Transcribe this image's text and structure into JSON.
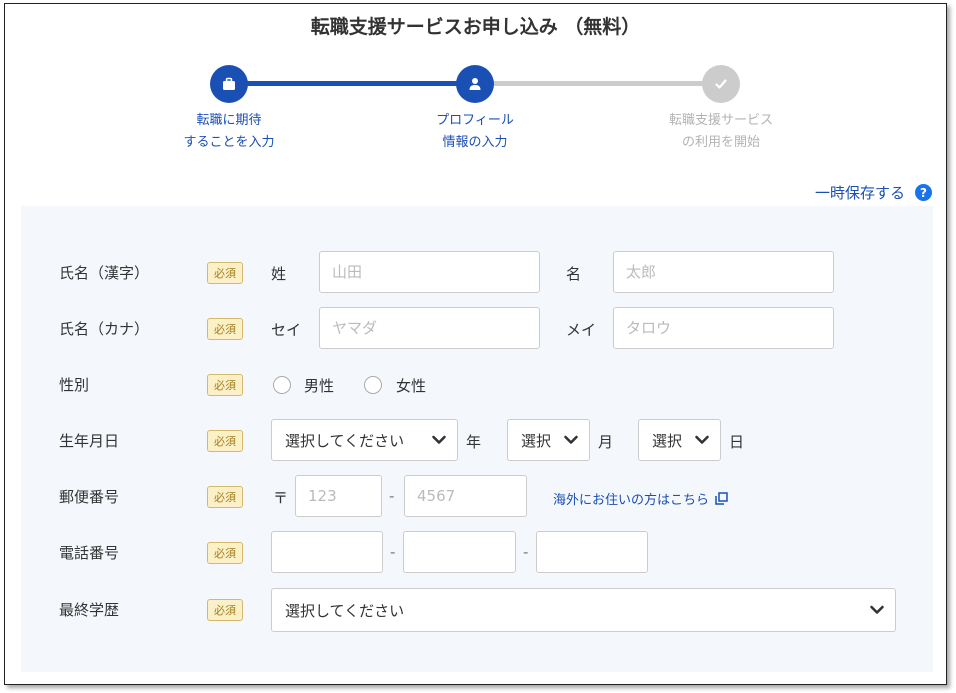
{
  "title": "転職支援サービスお申し込み （無料）",
  "steps": [
    {
      "line1": "転職に期待",
      "line2": "することを入力",
      "icon": "briefcase-icon",
      "state": "active"
    },
    {
      "line1": "プロフィール",
      "line2": "情報の入力",
      "icon": "person-icon",
      "state": "active"
    },
    {
      "line1": "転職支援サービス",
      "line2": "の利用を開始",
      "icon": "check-icon",
      "state": "inactive"
    }
  ],
  "save_link": "一時保存する",
  "help_icon": "?",
  "required_badge": "必須",
  "colors": {
    "accent": "#1a4fb4",
    "inactive": "#cccccc",
    "form_bg": "#f4f8fd",
    "badge_bg": "#fbf0c8"
  },
  "fields": {
    "name_kanji": {
      "label": "氏名（漢字）",
      "last_label": "姓",
      "last_placeholder": "山田",
      "first_label": "名",
      "first_placeholder": "太郎"
    },
    "name_kana": {
      "label": "氏名（カナ）",
      "last_label": "セイ",
      "last_placeholder": "ヤマダ",
      "first_label": "メイ",
      "first_placeholder": "タロウ"
    },
    "gender": {
      "label": "性別",
      "options": [
        "男性",
        "女性"
      ]
    },
    "birthdate": {
      "label": "生年月日",
      "year_value": "選択してください",
      "year_unit": "年",
      "month_value": "選択",
      "month_unit": "月",
      "day_value": "選択",
      "day_unit": "日"
    },
    "postal": {
      "label": "郵便番号",
      "symbol": "〒",
      "part1_placeholder": "123",
      "separator": "-",
      "part2_placeholder": "4567",
      "overseas_link": "海外にお住いの方はこちら"
    },
    "phone": {
      "label": "電話番号",
      "separator": "-"
    },
    "education": {
      "label": "最終学歴",
      "value": "選択してください"
    }
  }
}
